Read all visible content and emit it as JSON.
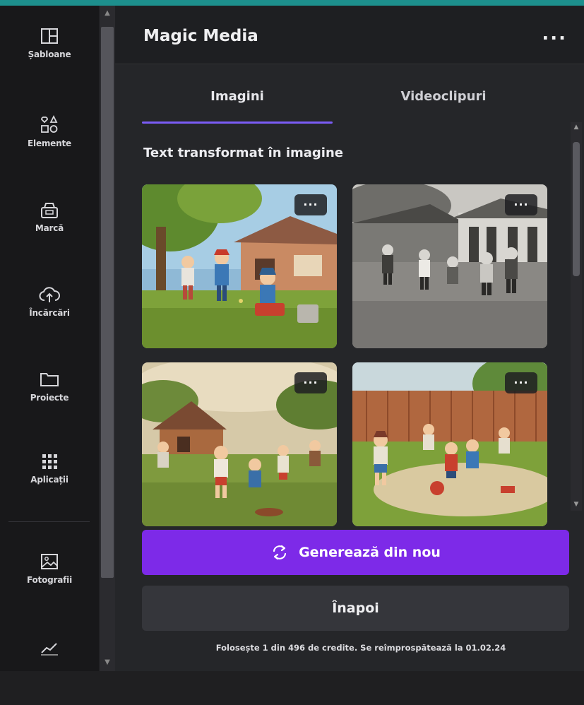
{
  "sidebar": {
    "items": [
      {
        "label": "Șabloane",
        "icon": "templates-icon"
      },
      {
        "label": "Elemente",
        "icon": "elements-icon"
      },
      {
        "label": "Marcă",
        "icon": "brand-icon"
      },
      {
        "label": "Încărcări",
        "icon": "upload-cloud-icon"
      },
      {
        "label": "Proiecte",
        "icon": "folder-icon"
      },
      {
        "label": "Aplicații",
        "icon": "apps-grid-icon"
      },
      {
        "label": "Fotografii",
        "icon": "photo-icon"
      }
    ]
  },
  "panel": {
    "title": "Magic Media",
    "more_label": "...",
    "tabs": [
      {
        "label": "Imagini",
        "active": true
      },
      {
        "label": "Videoclipuri",
        "active": false
      }
    ],
    "section_title": "Text transformat în imagine",
    "images": [
      {
        "name": "cartoon-children-playing-yard",
        "more_label": "..."
      },
      {
        "name": "black-and-white-children-playing",
        "more_label": "..."
      },
      {
        "name": "painted-children-running-field",
        "more_label": "..."
      },
      {
        "name": "cartoon-children-ball-backyard",
        "more_label": "..."
      }
    ],
    "generate_label": "Generează din nou",
    "back_label": "Înapoi",
    "credits_text": "Folosește 1 din 496 de credite. Se reîmprospătează la 01.02.24"
  },
  "colors": {
    "accent": "#7d2ae8",
    "tab_underline": "#7b5cf5",
    "background": "#252629",
    "sidebar": "#18181a",
    "top_accent": "#1d8f8d"
  }
}
